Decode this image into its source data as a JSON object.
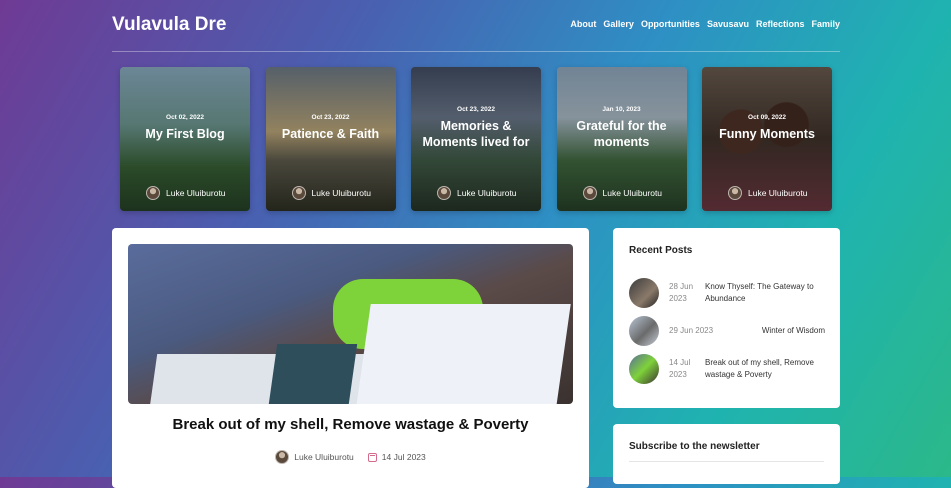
{
  "brand": "Vulavula Dre",
  "nav": [
    "About",
    "Gallery",
    "Opportunities",
    "Savusavu",
    "Reflections",
    "Family"
  ],
  "featured": [
    {
      "date": "Oct 02, 2022",
      "title": "My First Blog",
      "author": "Luke Uluiburotu"
    },
    {
      "date": "Oct 23, 2022",
      "title": "Patience & Faith",
      "author": "Luke Uluiburotu"
    },
    {
      "date": "Oct 23, 2022",
      "title": "Memories & Moments lived for",
      "author": "Luke Uluiburotu"
    },
    {
      "date": "Jan 10, 2023",
      "title": "Grateful for the moments",
      "author": "Luke Uluiburotu"
    },
    {
      "date": "Oct 09, 2022",
      "title": "Funny Moments",
      "author": "Luke Uluiburotu"
    }
  ],
  "post": {
    "title": "Break out of my shell, Remove wastage & Poverty",
    "author": "Luke Uluiburotu",
    "date": "14 Jul 2023"
  },
  "recent": {
    "heading": "Recent Posts",
    "items": [
      {
        "date": "28 Jun 2023",
        "title": "Know Thyself: The Gateway to Abundance"
      },
      {
        "date": "29 Jun 2023",
        "title": "Winter of Wisdom"
      },
      {
        "date": "14 Jul 2023",
        "title": "Break out of my shell, Remove wastage & Poverty"
      }
    ]
  },
  "subscribe": {
    "heading": "Subscribe to the newsletter"
  }
}
